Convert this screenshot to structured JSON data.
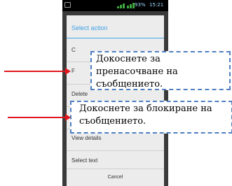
{
  "status_bar": {
    "battery": "93%",
    "time": "15:21"
  },
  "dialog": {
    "title": "Select action",
    "items": [
      "C",
      "F",
      "Delete",
      "",
      "View details",
      "Select text"
    ],
    "cancel_label": "Cancel"
  },
  "callouts": {
    "forward_hint": "Докоснете за пренасочване на съобщението.",
    "block_hint": "Докоснете за блокиране на съобщението."
  },
  "colors": {
    "dialog_accent": "#3da2e6",
    "callout_border": "#4f7fc1",
    "arrow": "#e0161e"
  }
}
